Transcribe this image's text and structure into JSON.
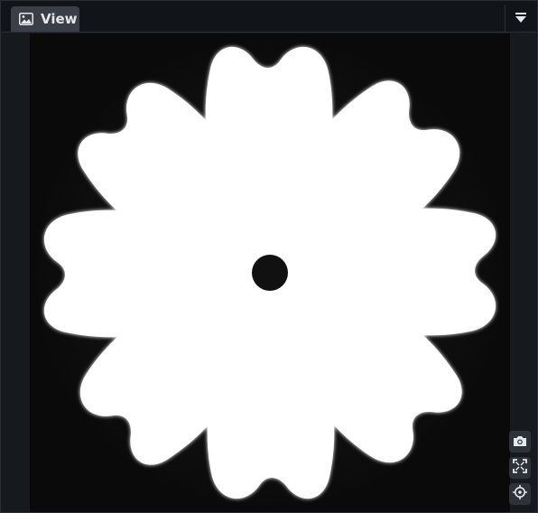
{
  "tab": {
    "label": "View",
    "icon": "image-icon"
  },
  "header": {
    "menu_icon": "dropdown-menu-icon"
  },
  "tools": [
    {
      "name": "screenshot",
      "icon": "camera-icon"
    },
    {
      "name": "fit-view",
      "icon": "fit-screen-icon"
    },
    {
      "name": "recenter",
      "icon": "crosshair-icon"
    }
  ],
  "colors": {
    "background": "#16191d",
    "tab_active": "#3a3f47",
    "tool_button": "#2e333a",
    "canvas": "#0d0d0d",
    "shape": "#ffffff"
  }
}
